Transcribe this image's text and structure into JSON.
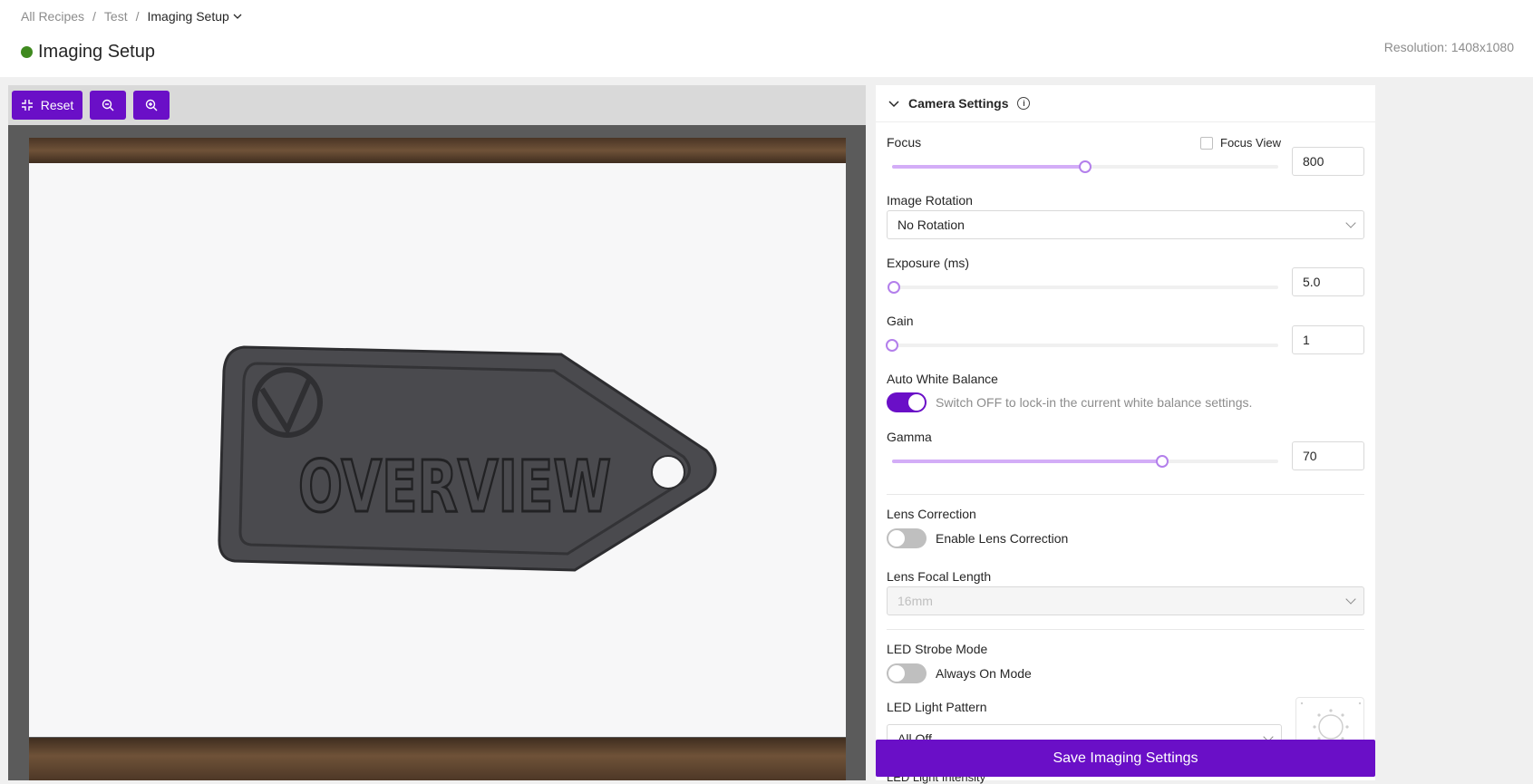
{
  "breadcrumb": {
    "items": [
      "All Recipes",
      "Test"
    ],
    "separator": "/",
    "current": "Imaging Setup"
  },
  "page": {
    "title": "Imaging Setup",
    "status_color": "#3f8a1f",
    "resolution": "Resolution: 1408x1080"
  },
  "toolbar": {
    "reset_label": "Reset",
    "zoom_out_icon": "zoom-out-icon",
    "zoom_in_icon": "zoom-in-icon"
  },
  "viewer": {
    "tag_text": "OVERVIEW"
  },
  "camera": {
    "header": "Camera Settings",
    "focus": {
      "label": "Focus",
      "value": "800",
      "fraction": 0.5,
      "focus_view_label": "Focus View"
    },
    "rotation": {
      "label": "Image Rotation",
      "value": "No Rotation"
    },
    "exposure": {
      "label": "Exposure (ms)",
      "value": "5.0",
      "fraction": 0.005
    },
    "gain": {
      "label": "Gain",
      "value": "1",
      "fraction": 0.0
    },
    "awb": {
      "label": "Auto White Balance",
      "hint": "Switch OFF to lock-in the current white balance settings.",
      "on": true
    },
    "gamma": {
      "label": "Gamma",
      "value": "70",
      "fraction": 0.7
    },
    "lens": {
      "label": "Lens Correction",
      "toggle_label": "Enable Lens Correction",
      "on": false
    },
    "focal": {
      "label": "Lens Focal Length",
      "value": "16mm"
    },
    "strobe": {
      "label": "LED Strobe Mode",
      "toggle_label": "Always On Mode",
      "on": false
    },
    "pattern": {
      "label": "LED Light Pattern",
      "value": "All Off"
    },
    "intensity_label": "LED Light Intensity"
  },
  "save_label": "Save Imaging Settings",
  "colors": {
    "accent": "#6a0fc7",
    "slider_track": "#d3adf7"
  }
}
